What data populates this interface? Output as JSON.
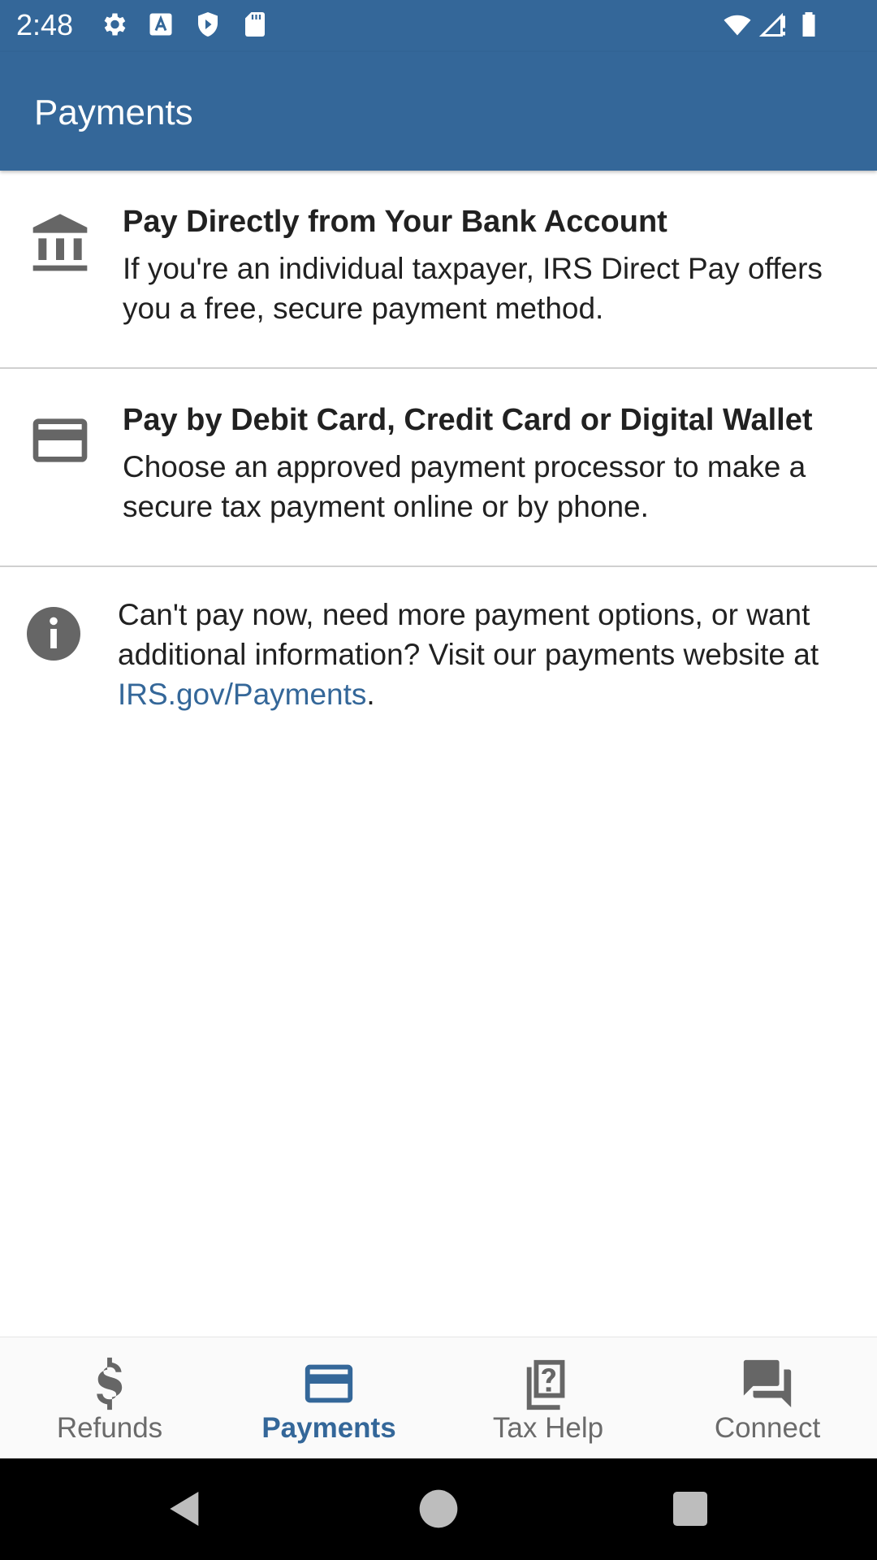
{
  "status_bar": {
    "time": "2:48",
    "icons": [
      "settings-icon",
      "font-a-icon",
      "shield-play-icon",
      "sd-card-icon",
      "wifi-icon",
      "signal-icon",
      "battery-icon"
    ]
  },
  "app_bar": {
    "title": "Payments"
  },
  "options": [
    {
      "icon": "bank-icon",
      "heading": "Pay Directly from Your Bank Account",
      "description": "If you're an individual taxpayer, IRS Direct Pay offers you a free, secure payment method."
    },
    {
      "icon": "credit-card-icon",
      "heading": "Pay by Debit Card, Credit Card or Digital Wallet",
      "description": "Choose an approved payment processor to make a secure tax payment online or by phone."
    }
  ],
  "info": {
    "icon": "info-icon",
    "text_before": "Can't pay now, need more payment options, or want additional information? Visit our payments website at ",
    "link_text": "IRS.gov/Payments",
    "text_after": "."
  },
  "bottom_nav": {
    "items": [
      {
        "label": "Refunds",
        "icon": "dollar-icon",
        "active": false
      },
      {
        "label": "Payments",
        "icon": "credit-card-icon",
        "active": true
      },
      {
        "label": "Tax Help",
        "icon": "help-document-icon",
        "active": false
      },
      {
        "label": "Connect",
        "icon": "chat-icon",
        "active": false
      }
    ]
  },
  "colors": {
    "primary": "#346799",
    "icon_gray": "#666666",
    "inactive_label": "#6b6b6b"
  }
}
